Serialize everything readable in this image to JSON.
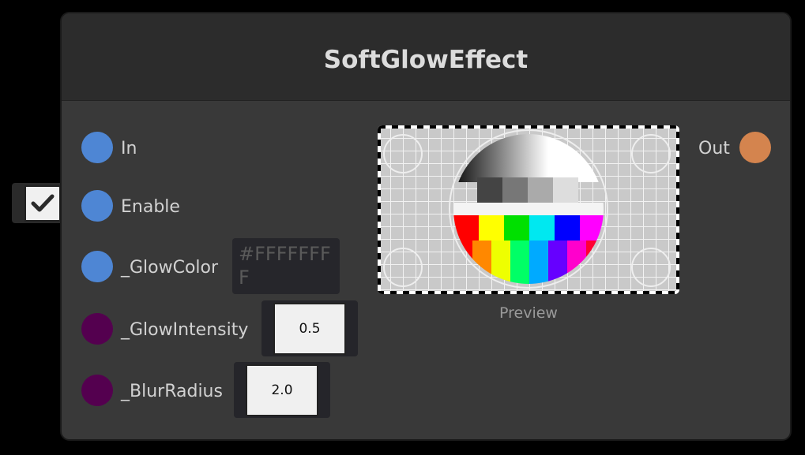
{
  "node": {
    "title": "SoftGlowEffect",
    "inputs": [
      {
        "label": "In"
      },
      {
        "label": "Enable"
      },
      {
        "label": "_GlowColor"
      },
      {
        "label": "_GlowIntensity"
      },
      {
        "label": "_BlurRadius"
      }
    ],
    "outputs": [
      {
        "label": "Out"
      }
    ],
    "fields": {
      "enable_checked": true,
      "glow_color": "#FFFFFFFF",
      "glow_intensity": "0.5",
      "blur_radius": "2.0"
    },
    "preview": {
      "caption": "Preview"
    }
  },
  "colors": {
    "port_blue": "#4e86d4",
    "port_purple": "#54004f",
    "port_orange": "#d4844e",
    "node_bg": "#393939",
    "header_bg": "#2c2c2c"
  },
  "icons": {
    "enable_checkbox": "checkmark-icon",
    "preview": "test-pattern-image"
  }
}
